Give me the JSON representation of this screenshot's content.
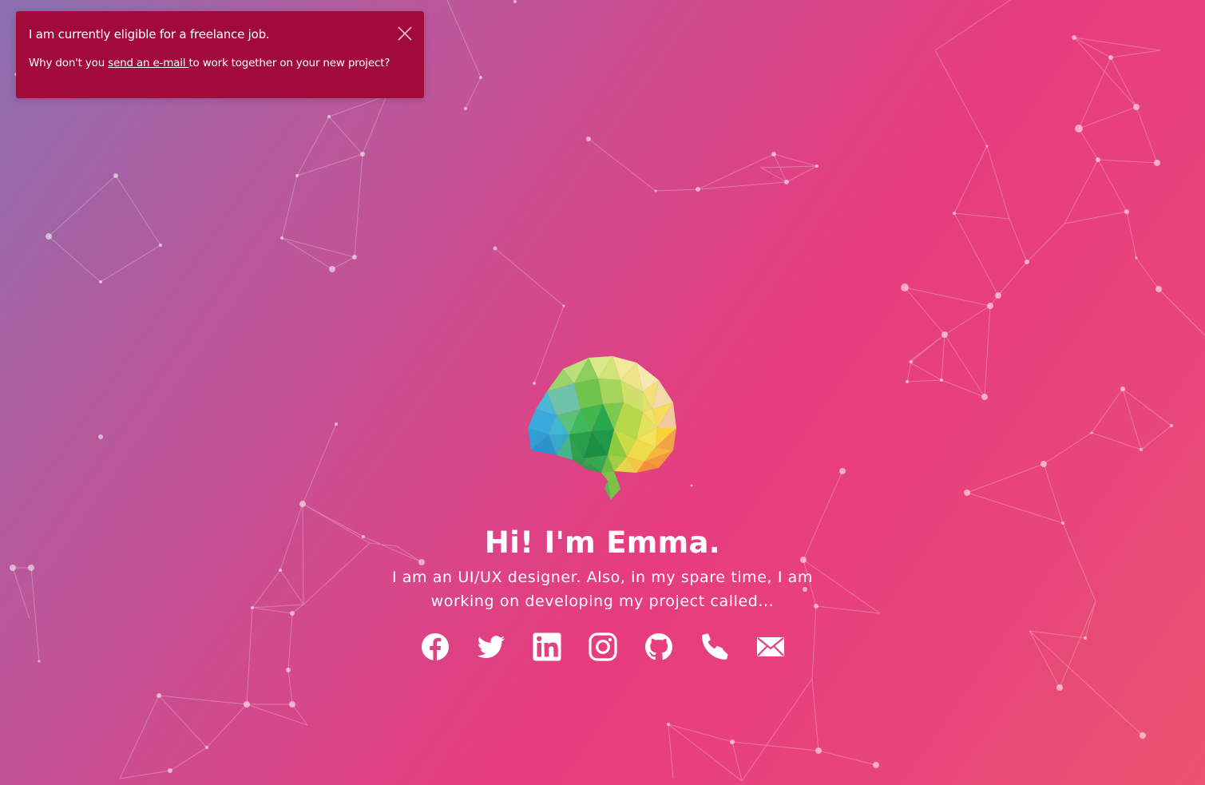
{
  "toast": {
    "title": "I am currently eligible for a freelance job.",
    "body_prefix": "Why don't you ",
    "link_text": "send an e-mail ",
    "body_suffix": "to work together on your new project?",
    "close_icon": "close-icon",
    "background": "#a20a3a"
  },
  "hero": {
    "logo_icon": "brain-icon",
    "title": "Hi! I'm Emma.",
    "subtitle": "I am an UI/UX designer. Also, in my spare time, I am working on developing my project called..."
  },
  "socials": [
    {
      "name": "facebook",
      "icon": "facebook-icon"
    },
    {
      "name": "twitter",
      "icon": "twitter-icon"
    },
    {
      "name": "linkedin",
      "icon": "linkedin-icon"
    },
    {
      "name": "instagram",
      "icon": "instagram-icon"
    },
    {
      "name": "github",
      "icon": "github-icon"
    },
    {
      "name": "phone",
      "icon": "phone-icon"
    },
    {
      "name": "email",
      "icon": "mail-icon"
    }
  ],
  "colors": {
    "gradient_start": "#8a6fb0",
    "gradient_mid": "#e73c7e",
    "gradient_end": "#ea5470",
    "text": "#ffffff"
  }
}
